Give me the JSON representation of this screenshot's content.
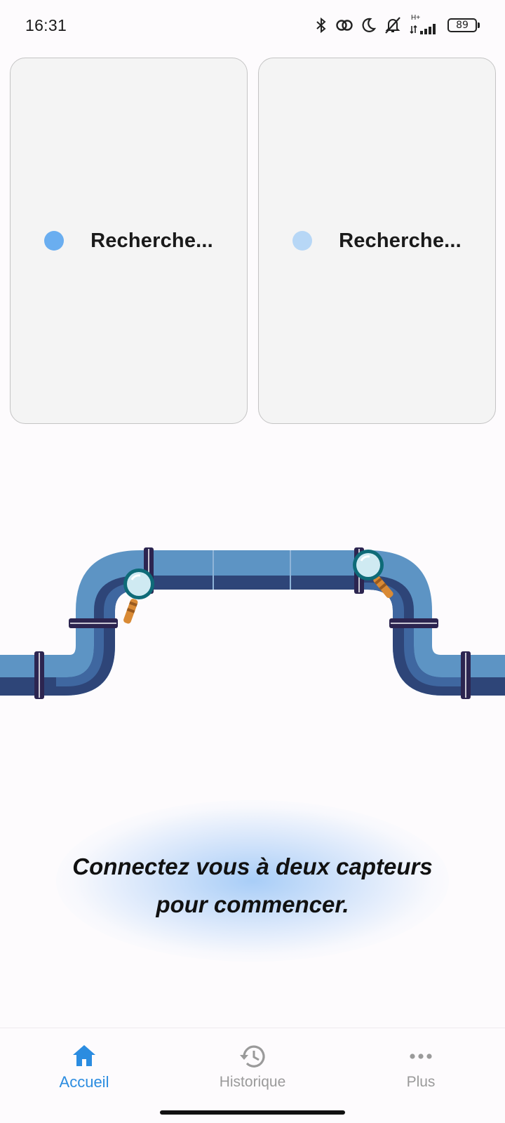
{
  "status_bar": {
    "time": "16:31",
    "battery": "89",
    "network": "H+"
  },
  "cards": [
    {
      "label": "Recherche...",
      "dot_color": "#6aaef0"
    },
    {
      "label": "Recherche...",
      "dot_color": "#b7d7f6"
    }
  ],
  "message": {
    "line1": "Connectez vous à deux capteurs",
    "line2": "pour commencer."
  },
  "nav": {
    "home": "Accueil",
    "history": "Historique",
    "more": "Plus"
  },
  "colors": {
    "accent": "#2b8ce0",
    "nav_inactive": "#9a9a9a",
    "pipe_light": "#5d94c4",
    "pipe_dark": "#2e4578"
  }
}
